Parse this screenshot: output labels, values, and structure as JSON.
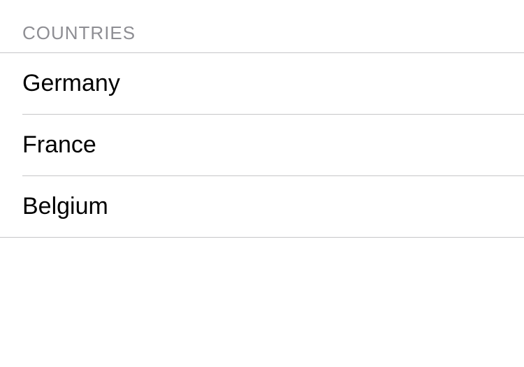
{
  "section": {
    "title": "Countries",
    "items": [
      {
        "label": "Germany"
      },
      {
        "label": "France"
      },
      {
        "label": "Belgium"
      }
    ]
  }
}
